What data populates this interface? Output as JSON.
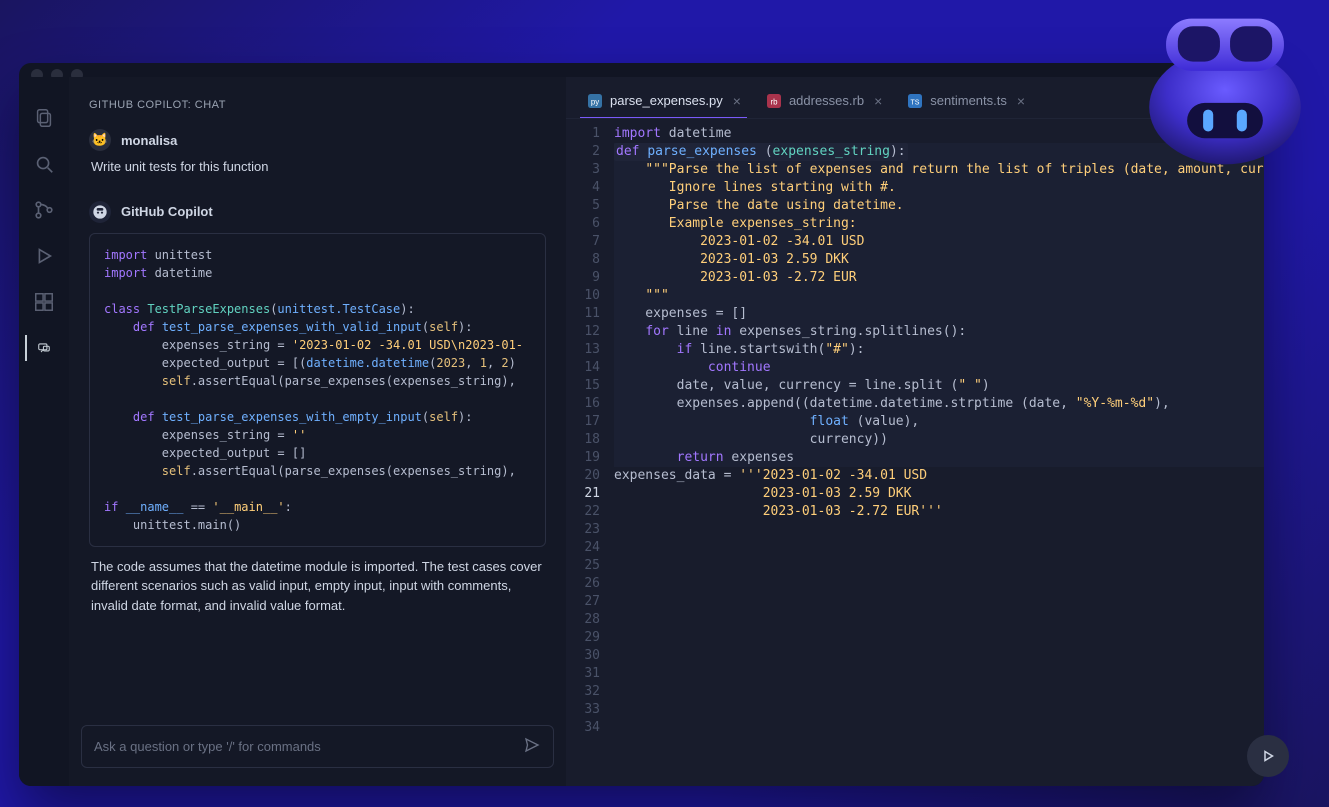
{
  "chat": {
    "header": "GITHUB COPILOT: CHAT",
    "user_name": "monalisa",
    "user_prompt": "Write unit tests for this function",
    "bot_name": "GitHub Copilot",
    "bot_explain": "The code assumes that the datetime module is imported. The test cases cover different scenarios such as valid input, empty input, input with comments, invalid date format, and invalid value format.",
    "input_placeholder": "Ask a question or type '/' for commands"
  },
  "tabs": [
    {
      "label": "parse_expenses.py",
      "icon": "py",
      "active": true
    },
    {
      "label": "addresses.rb",
      "icon": "rb",
      "active": false
    },
    {
      "label": "sentiments.ts",
      "icon": "ts",
      "active": false
    }
  ],
  "activity_icons": [
    "files",
    "search",
    "git",
    "debug",
    "extensions",
    "chat"
  ],
  "chat_code": {
    "lines": [
      [
        [
          "kw",
          "import"
        ],
        [
          "op",
          " unittest"
        ]
      ],
      [
        [
          "kw",
          "import"
        ],
        [
          "op",
          " datetime"
        ]
      ],
      [
        [
          "op",
          ""
        ]
      ],
      [
        [
          "kw",
          "class "
        ],
        [
          "cls",
          "TestParseExpenses"
        ],
        [
          "op",
          "("
        ],
        [
          "fn",
          "unittest.TestCase"
        ],
        [
          "op",
          "):"
        ]
      ],
      [
        [
          "op",
          "    "
        ],
        [
          "kw",
          "def "
        ],
        [
          "fn",
          "test_parse_expenses_with_valid_input"
        ],
        [
          "op",
          "("
        ],
        [
          "self",
          "self"
        ],
        [
          "op",
          "):"
        ]
      ],
      [
        [
          "op",
          "        expenses_string = "
        ],
        [
          "str",
          "'2023-01-02 -34.01 USD\\n2023-01-"
        ]
      ],
      [
        [
          "op",
          "        expected_output = [("
        ],
        [
          "fn",
          "datetime.datetime"
        ],
        [
          "op",
          "("
        ],
        [
          "num",
          "2023"
        ],
        [
          "op",
          ", "
        ],
        [
          "num",
          "1"
        ],
        [
          "op",
          ", "
        ],
        [
          "num",
          "2"
        ],
        [
          "op",
          ")"
        ]
      ],
      [
        [
          "op",
          "        "
        ],
        [
          "self",
          "self"
        ],
        [
          "op",
          ".assertEqual(parse_expenses(expenses_string),"
        ]
      ],
      [
        [
          "op",
          ""
        ]
      ],
      [
        [
          "op",
          "    "
        ],
        [
          "kw",
          "def "
        ],
        [
          "fn",
          "test_parse_expenses_with_empty_input"
        ],
        [
          "op",
          "("
        ],
        [
          "self",
          "self"
        ],
        [
          "op",
          "):"
        ]
      ],
      [
        [
          "op",
          "        expenses_string = "
        ],
        [
          "str",
          "''"
        ]
      ],
      [
        [
          "op",
          "        expected_output = []"
        ]
      ],
      [
        [
          "op",
          "        "
        ],
        [
          "self",
          "self"
        ],
        [
          "op",
          ".assertEqual(parse_expenses(expenses_string),"
        ]
      ],
      [
        [
          "op",
          ""
        ]
      ],
      [
        [
          "kw",
          "if "
        ],
        [
          "fn",
          "__name__"
        ],
        [
          "op",
          " == "
        ],
        [
          "str",
          "'__main__'"
        ],
        [
          "op",
          ":"
        ]
      ],
      [
        [
          "op",
          "    unittest.main()"
        ]
      ]
    ]
  },
  "editor_code": {
    "current_line": 21,
    "total_lines": 34,
    "lines": [
      [
        [
          "kw",
          "import"
        ],
        [
          "op",
          " datetime"
        ]
      ],
      [
        [
          "op",
          ""
        ]
      ],
      [
        [
          "hl-start",
          ""
        ],
        [
          "kw",
          "def "
        ],
        [
          "fn",
          "parse_expenses "
        ],
        [
          "op",
          "("
        ],
        [
          "cls",
          "expenses_string"
        ],
        [
          "op",
          "):"
        ],
        [
          "hl-end",
          ""
        ]
      ],
      [
        [
          "op",
          "    "
        ],
        [
          "str",
          "\"\"\"Parse the list of expenses and return the list of triples (date, amount, currency"
        ]
      ],
      [
        [
          "op",
          "       "
        ],
        [
          "str",
          "Ignore lines starting with #."
        ]
      ],
      [
        [
          "op",
          "       "
        ],
        [
          "str",
          "Parse the date using datetime."
        ]
      ],
      [
        [
          "op",
          "       "
        ],
        [
          "str",
          "Example expenses_string:"
        ]
      ],
      [
        [
          "op",
          "           "
        ],
        [
          "str",
          "2023-01-02 -34.01 USD"
        ]
      ],
      [
        [
          "op",
          "           "
        ],
        [
          "str",
          "2023-01-03 2.59 DKK"
        ]
      ],
      [
        [
          "op",
          "           "
        ],
        [
          "str",
          "2023-01-03 -2.72 EUR"
        ]
      ],
      [
        [
          "op",
          "    "
        ],
        [
          "str",
          "\"\"\""
        ]
      ],
      [
        [
          "op",
          "    expenses = []"
        ]
      ],
      [
        [
          "op",
          ""
        ]
      ],
      [
        [
          "op",
          "    "
        ],
        [
          "kw",
          "for"
        ],
        [
          "op",
          " line "
        ],
        [
          "kw",
          "in"
        ],
        [
          "op",
          " expenses_string.splitlines():"
        ]
      ],
      [
        [
          "op",
          "        "
        ],
        [
          "kw",
          "if"
        ],
        [
          "op",
          " line.startswith("
        ],
        [
          "str",
          "\"#\""
        ],
        [
          "op",
          "):"
        ]
      ],
      [
        [
          "op",
          "            "
        ],
        [
          "kw",
          "continue"
        ]
      ],
      [
        [
          "op",
          "        date, value, currency = line.split ("
        ],
        [
          "str",
          "\" \""
        ],
        [
          "op",
          ")"
        ]
      ],
      [
        [
          "op",
          "        expenses.append((datetime.datetime.strptime (date, "
        ],
        [
          "str",
          "\"%Y-%m-%d\""
        ],
        [
          "op",
          "),"
        ]
      ],
      [
        [
          "op",
          "                         "
        ],
        [
          "fn",
          "float"
        ],
        [
          "op",
          " (value),"
        ]
      ],
      [
        [
          "op",
          "                         currency))"
        ]
      ],
      [
        [
          "op",
          "        "
        ],
        [
          "kw",
          "return"
        ],
        [
          "op",
          " expenses"
        ]
      ],
      [
        [
          "op",
          ""
        ]
      ],
      [
        [
          "op",
          "expenses_data = "
        ],
        [
          "str",
          "'''2023-01-02 -34.01 USD"
        ]
      ],
      [
        [
          "op",
          "                   "
        ],
        [
          "str",
          "2023-01-03 2.59 DKK"
        ]
      ],
      [
        [
          "op",
          "                   "
        ],
        [
          "str",
          "2023-01-03 -2.72 EUR'''"
        ]
      ]
    ]
  }
}
